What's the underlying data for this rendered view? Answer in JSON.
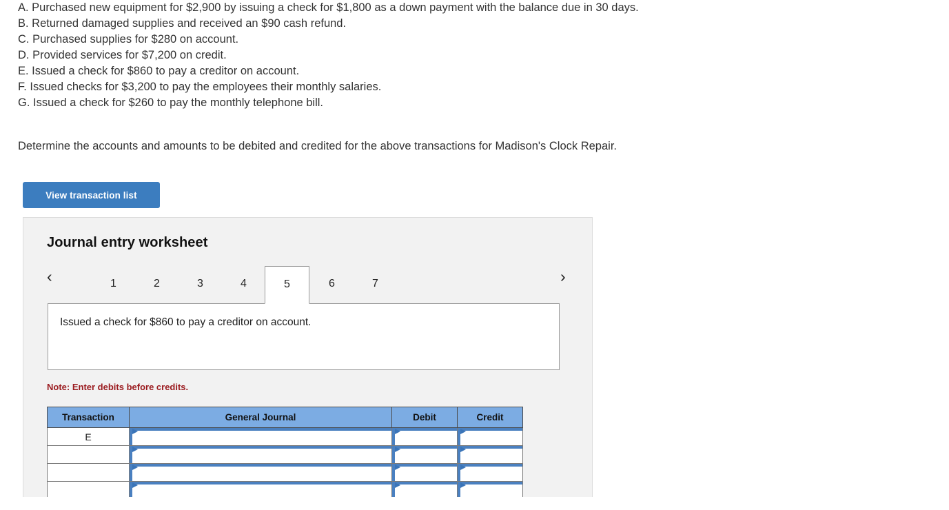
{
  "transactions": [
    "A. Purchased new equipment for $2,900 by issuing a check for $1,800 as a down payment with the balance due in 30 days.",
    "B. Returned damaged supplies and received an $90 cash refund.",
    "C. Purchased supplies for $280 on account.",
    "D. Provided services for $7,200 on credit.",
    "E. Issued a check for $860 to pay a creditor on account.",
    "F. Issued checks for $3,200 to pay the employees their monthly salaries.",
    "G. Issued a check for $260 to pay the monthly telephone bill."
  ],
  "prompt": "Determine the accounts and amounts to be debited and credited for the above transactions for Madison's Clock Repair.",
  "view_button_label": "View transaction list",
  "worksheet": {
    "title": "Journal entry worksheet",
    "prev_icon": "chevron-left-icon",
    "next_icon": "chevron-right-icon",
    "prev_glyph": "‹",
    "next_glyph": "›",
    "tabs": [
      "1",
      "2",
      "3",
      "4",
      "5",
      "6",
      "7"
    ],
    "active_tab": "5",
    "description": "Issued a check for $860 to pay a creditor on account.",
    "note": "Note: Enter debits before credits.",
    "table": {
      "headers": [
        "Transaction",
        "General Journal",
        "Debit",
        "Credit"
      ],
      "rows": [
        {
          "transaction": "E",
          "general_journal": "",
          "debit": "",
          "credit": ""
        },
        {
          "transaction": "",
          "general_journal": "",
          "debit": "",
          "credit": ""
        },
        {
          "transaction": "",
          "general_journal": "",
          "debit": "",
          "credit": ""
        },
        {
          "transaction": "",
          "general_journal": "",
          "debit": "",
          "credit": ""
        }
      ]
    }
  },
  "colors": {
    "button_blue": "#3c7dbf",
    "header_blue": "#7cace3",
    "cell_border_blue": "#4a80c0",
    "note_red": "#9b1c20",
    "panel_gray": "#f2f2f2"
  }
}
